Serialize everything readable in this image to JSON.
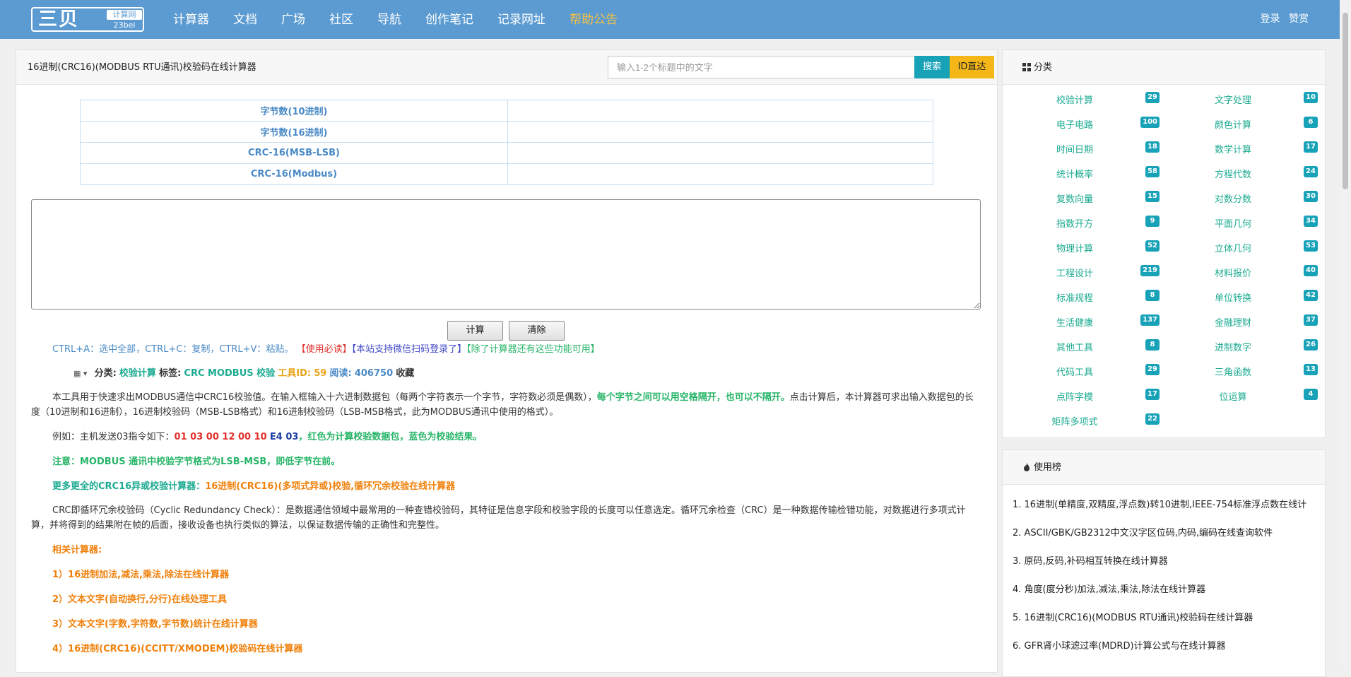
{
  "nav": {
    "logo_main": "三贝",
    "logo_sub": "计算网",
    "logo_domain": "23bei",
    "items": [
      "计算器",
      "文档",
      "广场",
      "社区",
      "导航",
      "创作笔记",
      "记录网址",
      "帮助公告"
    ],
    "login": "登录",
    "reward": "赞赏",
    "highlight_color": "#f5c141"
  },
  "main": {
    "title": "16进制(CRC16)(MODBUS RTU通讯)校验码在线计算器",
    "search_placeholder": "输入1-2个标题中的文字",
    "search_btn": "搜索",
    "id_btn": "ID直达",
    "result_rows": [
      "字节数(10进制)",
      "字节数(16进制)",
      "CRC-16(MSB-LSB)",
      "CRC-16(Modbus)"
    ],
    "calc_btn": "计算",
    "clear_btn": "清除",
    "shortcut": "CTRL+A：选中全部，CTRL+C：复制，CTRL+V：粘贴。",
    "notice_red": "【使用必读】",
    "notice_purple": "【本站支持微信扫码登录了】",
    "notice_green": "【除了计算器还有这些功能可用】",
    "meta": {
      "cat_label": "分类:",
      "cat_value": "校验计算",
      "tag_label": "标签:",
      "tag_value": "CRC MODBUS 校验",
      "id_label": "工具ID:",
      "id_value": "59",
      "read_label": "阅读:",
      "read_value": "406750",
      "fav": "收藏"
    },
    "desc1_a": "本工具用于快速求出MODBUS通信中CRC16校验值。在输入框输入十六进制数据包（每两个字符表示一个字节，字符数必须是偶数），",
    "desc1_b": "每个字节之间可以用空格隔开，也可以不隔开。",
    "desc1_c": "点击计算后，本计算器可求出输入数据包的长度（10进制和16进制），16进制校验码（MSB-LSB格式）和16进制校验码（LSB-MSB格式，此为MODBUS通讯中使用的格式）。",
    "example_a": "例如：主机发送03指令如下：",
    "example_red": "01 03 00 12 00 10",
    "example_blue": "E4 03",
    "example_green": "，红色为计算校验数据包，蓝色为校验结果。",
    "note": "注意：MODBUS 通讯中校验字节格式为LSB-MSB，即低字节在前。",
    "more_a": "更多更全的CRC16异或校验计算器：",
    "more_b": "16进制(CRC16)(多项式异或)校验,循环冗余校验在线计算器",
    "crc_desc": "CRC即循环冗余校验码（Cyclic Redundancy Check）：是数据通信领域中最常用的一种查错校验码，其特征是信息字段和校验字段的长度可以任意选定。循环冗余检查（CRC）是一种数据传输检错功能，对数据进行多项式计算，并将得到的结果附在帧的后面，接收设备也执行类似的算法，以保证数据传输的正确性和完整性。",
    "related_title": "相关计算器:",
    "related": [
      "1）16进制加法,减法,乘法,除法在线计算器",
      "2）文本文字(自动换行,分行)在线处理工具",
      "3）文本文字(字数,字符数,字节数)统计在线计算器",
      "4）16进制(CRC16)(CCITT/XMODEM)校验码在线计算器"
    ]
  },
  "categories": {
    "title": "分类",
    "items": [
      {
        "name": "校验计算",
        "count": "29"
      },
      {
        "name": "文字处理",
        "count": "10"
      },
      {
        "name": "电子电路",
        "count": "100"
      },
      {
        "name": "颜色计算",
        "count": "6"
      },
      {
        "name": "时间日期",
        "count": "18"
      },
      {
        "name": "数学计算",
        "count": "17"
      },
      {
        "name": "统计概率",
        "count": "58"
      },
      {
        "name": "方程代数",
        "count": "24"
      },
      {
        "name": "复数向量",
        "count": "15"
      },
      {
        "name": "对数分数",
        "count": "30"
      },
      {
        "name": "指数开方",
        "count": "9"
      },
      {
        "name": "平面几何",
        "count": "34"
      },
      {
        "name": "物理计算",
        "count": "52"
      },
      {
        "name": "立体几何",
        "count": "53"
      },
      {
        "name": "工程设计",
        "count": "219"
      },
      {
        "name": "材料报价",
        "count": "40"
      },
      {
        "name": "标准规程",
        "count": "8"
      },
      {
        "name": "单位转换",
        "count": "42"
      },
      {
        "name": "生活健康",
        "count": "137"
      },
      {
        "name": "金融理财",
        "count": "37"
      },
      {
        "name": "其他工具",
        "count": "8"
      },
      {
        "name": "进制数字",
        "count": "26"
      },
      {
        "name": "代码工具",
        "count": "29"
      },
      {
        "name": "三角函数",
        "count": "13"
      },
      {
        "name": "点阵字模",
        "count": "17"
      },
      {
        "name": "位运算",
        "count": "4"
      },
      {
        "name": "矩阵多项式",
        "count": "22"
      }
    ]
  },
  "ranking": {
    "title": "使用榜",
    "items": [
      "1. 16进制(单精度,双精度,浮点数)转10进制,IEEE-754标准浮点数在线计",
      "2. ASCII/GBK/GB2312中文汉字区位码,内码,编码在线查询软件",
      "3. 原码,反码,补码相互转换在线计算器",
      "4. 角度(度分秒)加法,减法,乘法,除法在线计算器",
      "5. 16进制(CRC16)(MODBUS RTU通讯)校验码在线计算器",
      "6. GFR肾小球滤过率(MDRD)计算公式与在线计算器"
    ]
  }
}
